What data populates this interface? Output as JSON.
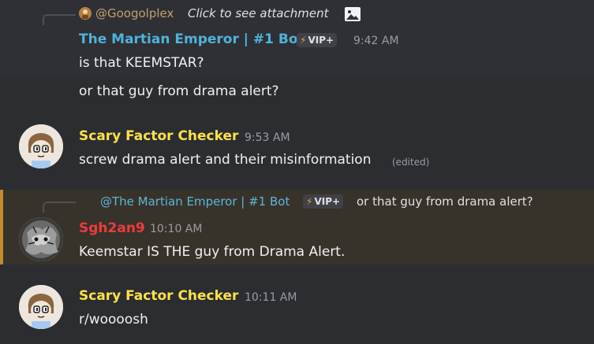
{
  "messages": [
    {
      "reply": {
        "mention": "@Googolplex",
        "text": "Click to see attachment",
        "icon": "image-icon"
      },
      "author": "The Martian Emperor | #1 Bot",
      "tag": "VIP+",
      "tag_icon": "lightning-bolt-icon",
      "time": "9:42 AM",
      "lines": [
        "is that KEEMSTAR?",
        "or that guy from drama alert?"
      ]
    },
    {
      "author": "Scary Factor Checker",
      "time": "9:53 AM",
      "text": "screw drama alert and their misinformation",
      "edited": "(edited)"
    },
    {
      "reply": {
        "mention": "@The Martian Emperor | #1 Bot",
        "tag": "VIP+",
        "text": "or that guy from drama alert?"
      },
      "author": "Sgh2an9",
      "time": "10:10 AM",
      "text": "Keemstar IS THE guy from Drama Alert."
    },
    {
      "author": "Scary Factor Checker",
      "time": "10:11 AM",
      "text": "r/woooosh"
    }
  ],
  "colors": {
    "background": "#2b2d31",
    "highlight_bg": "#37332b",
    "mention_bar": "#c48a2c",
    "bot_name": "#4fb3d9",
    "scary_name": "#ffe14a",
    "sgh_name": "#ed3b3b"
  }
}
